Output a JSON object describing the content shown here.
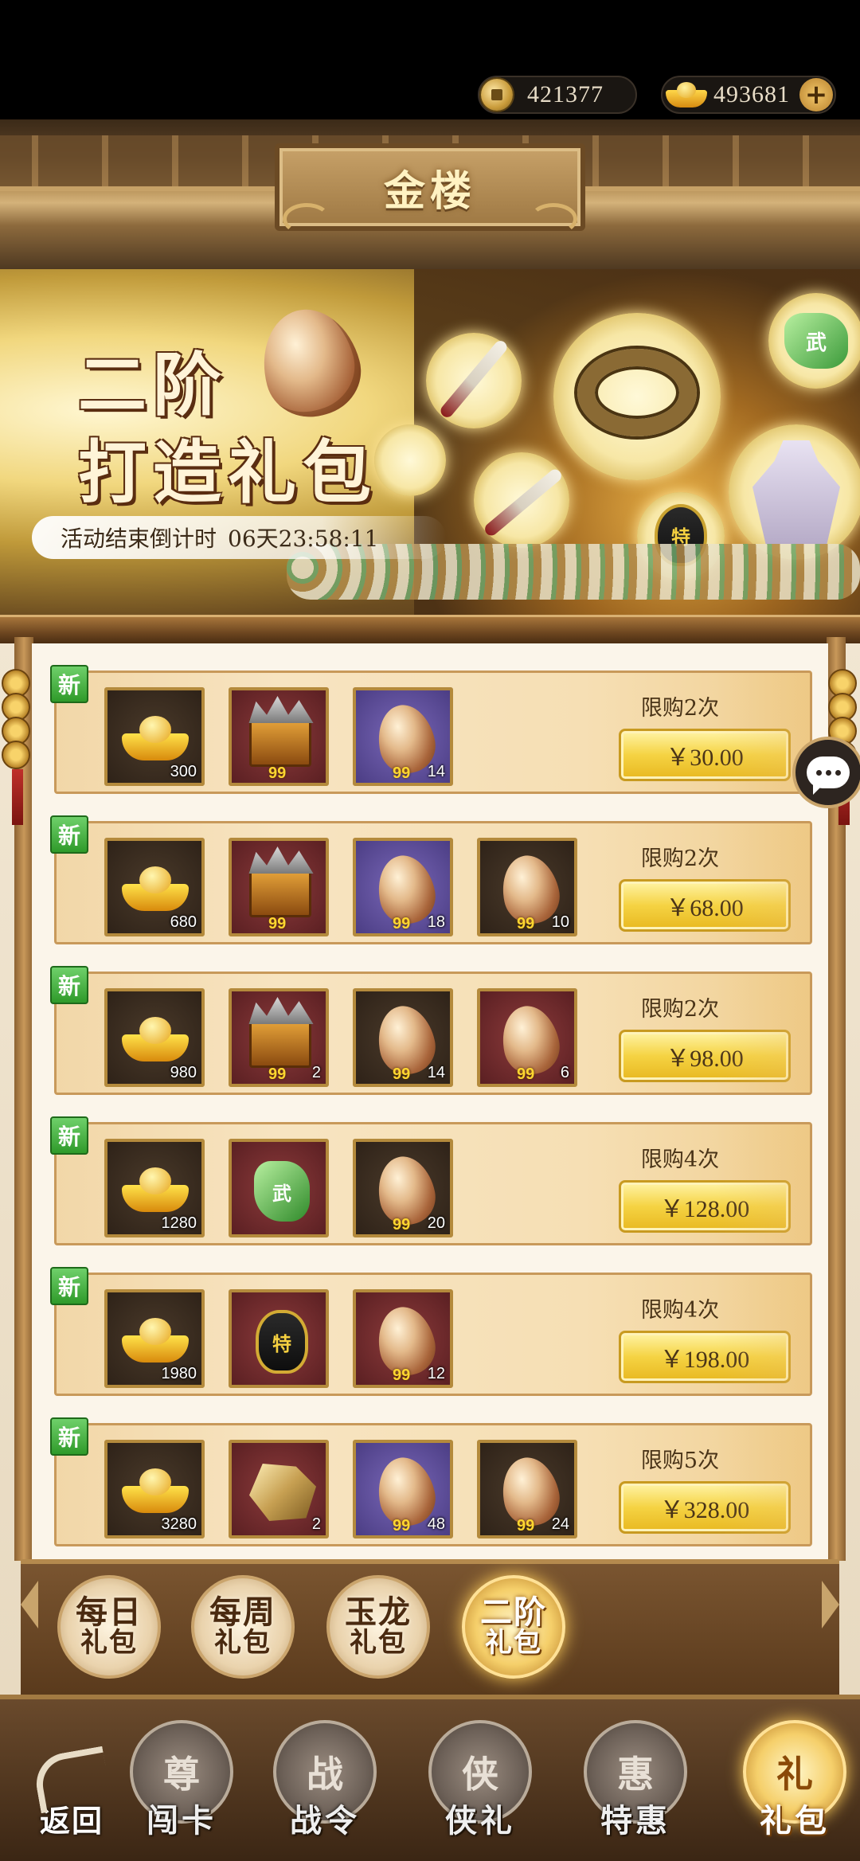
{
  "currency": {
    "coins": "421377",
    "ingots": "493681",
    "coin_icon": "copper-coin-icon",
    "ingot_icon": "gold-ingot-icon",
    "add_icon": "plus-icon"
  },
  "header": {
    "title": "金楼"
  },
  "banner": {
    "title_line1": "二阶",
    "title_line2": "打造礼包",
    "countdown_label": "活动结束倒计时",
    "countdown_time": "06天23:58:11",
    "item_jade_mark": "武",
    "item_token_mark": "特"
  },
  "offers": [
    {
      "new": "新",
      "limit": "限购2次",
      "price": "￥30.00",
      "items": [
        {
          "type": "ingot",
          "frame": "dark",
          "qty": "300",
          "badge": ""
        },
        {
          "type": "chest",
          "frame": "red",
          "qty": "",
          "badge": "99"
        },
        {
          "type": "shell",
          "frame": "purple",
          "qty": "14",
          "badge": "99"
        }
      ]
    },
    {
      "new": "新",
      "limit": "限购2次",
      "price": "￥68.00",
      "items": [
        {
          "type": "ingot",
          "frame": "dark",
          "qty": "680",
          "badge": ""
        },
        {
          "type": "chest",
          "frame": "red",
          "qty": "",
          "badge": "99"
        },
        {
          "type": "shell",
          "frame": "purple",
          "qty": "18",
          "badge": "99"
        },
        {
          "type": "shell",
          "frame": "dark",
          "qty": "10",
          "badge": "99"
        }
      ]
    },
    {
      "new": "新",
      "limit": "限购2次",
      "price": "￥98.00",
      "items": [
        {
          "type": "ingot",
          "frame": "dark",
          "qty": "980",
          "badge": ""
        },
        {
          "type": "chest",
          "frame": "red",
          "qty": "2",
          "badge": "99"
        },
        {
          "type": "shell",
          "frame": "dark",
          "qty": "14",
          "badge": "99"
        },
        {
          "type": "shell",
          "frame": "red",
          "qty": "6",
          "badge": "99"
        }
      ]
    },
    {
      "new": "新",
      "limit": "限购4次",
      "price": "￥128.00",
      "items": [
        {
          "type": "ingot",
          "frame": "dark",
          "qty": "1280",
          "badge": ""
        },
        {
          "type": "jade",
          "frame": "red",
          "qty": "",
          "badge": "",
          "mark": "武"
        },
        {
          "type": "shell",
          "frame": "dark",
          "qty": "20",
          "badge": "99"
        }
      ]
    },
    {
      "new": "新",
      "limit": "限购4次",
      "price": "￥198.00",
      "items": [
        {
          "type": "ingot",
          "frame": "dark",
          "qty": "1980",
          "badge": ""
        },
        {
          "type": "token",
          "frame": "red",
          "qty": "",
          "badge": "",
          "mark": "特"
        },
        {
          "type": "shell",
          "frame": "red",
          "qty": "12",
          "badge": "99"
        }
      ]
    },
    {
      "new": "新",
      "limit": "限购5次",
      "price": "￥328.00",
      "items": [
        {
          "type": "ingot",
          "frame": "dark",
          "qty": "3280",
          "badge": ""
        },
        {
          "type": "ore",
          "frame": "red",
          "qty": "2",
          "badge": ""
        },
        {
          "type": "shell",
          "frame": "purple",
          "qty": "48",
          "badge": "99"
        },
        {
          "type": "shell",
          "frame": "dark",
          "qty": "24",
          "badge": "99"
        }
      ]
    }
  ],
  "tabs": [
    {
      "line1": "每日",
      "line2": "礼包",
      "active": false
    },
    {
      "line1": "每周",
      "line2": "礼包",
      "active": false
    },
    {
      "line1": "玉龙",
      "line2": "礼包",
      "active": false
    },
    {
      "line1": "二阶",
      "line2": "礼包",
      "active": true
    }
  ],
  "nav": {
    "back_label": "返回",
    "items": [
      {
        "label": "闯卡",
        "glyph": "尊",
        "active": false
      },
      {
        "label": "战令",
        "glyph": "战",
        "active": false
      },
      {
        "label": "侠礼",
        "glyph": "侠",
        "active": false
      },
      {
        "label": "特惠",
        "glyph": "惠",
        "active": false
      },
      {
        "label": "礼包",
        "glyph": "礼",
        "active": true
      }
    ]
  },
  "chat_icon": "chat-bubble-icon",
  "colors": {
    "accent_gold": "#f5d343",
    "new_badge_green": "#3fae3a",
    "frame_brown": "#c8995a"
  }
}
